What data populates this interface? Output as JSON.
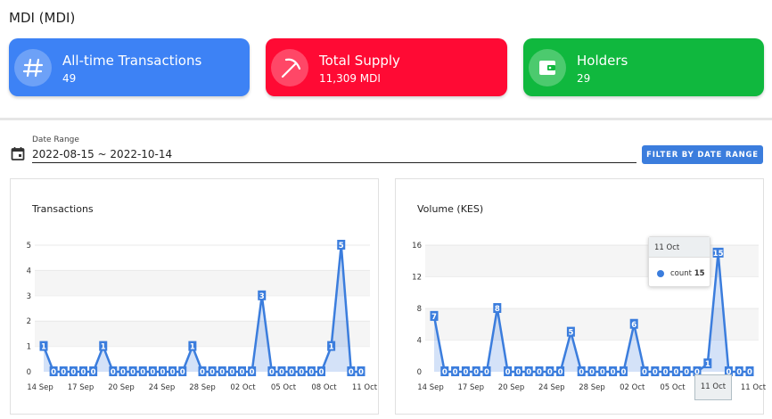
{
  "page": {
    "title": "MDI (MDI)"
  },
  "stats": [
    {
      "label": "All-time Transactions",
      "value": "49",
      "icon": "hash-icon",
      "color": "#3d82f5"
    },
    {
      "label": "Total Supply",
      "value": "11,309 MDI",
      "icon": "pickaxe-icon",
      "color": "#ff0a34"
    },
    {
      "label": "Holders",
      "value": "29",
      "icon": "wallet-icon",
      "color": "#10b83e"
    }
  ],
  "filter": {
    "label": "Date Range",
    "value": "2022-08-15 ~ 2022-10-14",
    "button": "FILTER BY DATE RANGE"
  },
  "chart_data": [
    {
      "type": "area",
      "title": "Transactions",
      "x_tick_labels": [
        "14 Sep",
        "17 Sep",
        "20 Sep",
        "24 Sep",
        "28 Sep",
        "02 Oct",
        "05 Oct",
        "08 Oct",
        "11 Oct"
      ],
      "y_ticks": [
        0,
        1,
        2,
        3,
        4,
        5
      ],
      "ylim": [
        0,
        5
      ],
      "values": [
        1,
        0,
        0,
        0,
        0,
        0,
        1,
        0,
        0,
        0,
        0,
        0,
        0,
        0,
        0,
        1,
        0,
        0,
        0,
        0,
        0,
        0,
        3,
        0,
        0,
        0,
        0,
        0,
        0,
        1,
        5,
        0,
        0
      ],
      "color": "#3b7ddd"
    },
    {
      "type": "area",
      "title": "Volume (KES)",
      "x_tick_labels": [
        "14 Sep",
        "17 Sep",
        "20 Sep",
        "24 Sep",
        "28 Sep",
        "02 Oct",
        "05 Oct",
        "08 Oct",
        "11 Oct"
      ],
      "y_ticks": [
        0,
        4,
        8,
        12,
        16
      ],
      "ylim": [
        0,
        16
      ],
      "values": [
        7,
        0,
        0,
        0,
        0,
        0,
        8,
        0,
        0,
        0,
        0,
        0,
        0,
        5,
        0,
        0,
        0,
        0,
        0,
        6,
        0,
        0,
        0,
        0,
        0,
        0,
        1,
        15,
        0,
        0,
        0
      ],
      "color": "#3b7ddd",
      "tooltip": {
        "date": "11 Oct",
        "series": "count",
        "value": "15"
      },
      "crosshair_label": "11 Oct"
    }
  ]
}
